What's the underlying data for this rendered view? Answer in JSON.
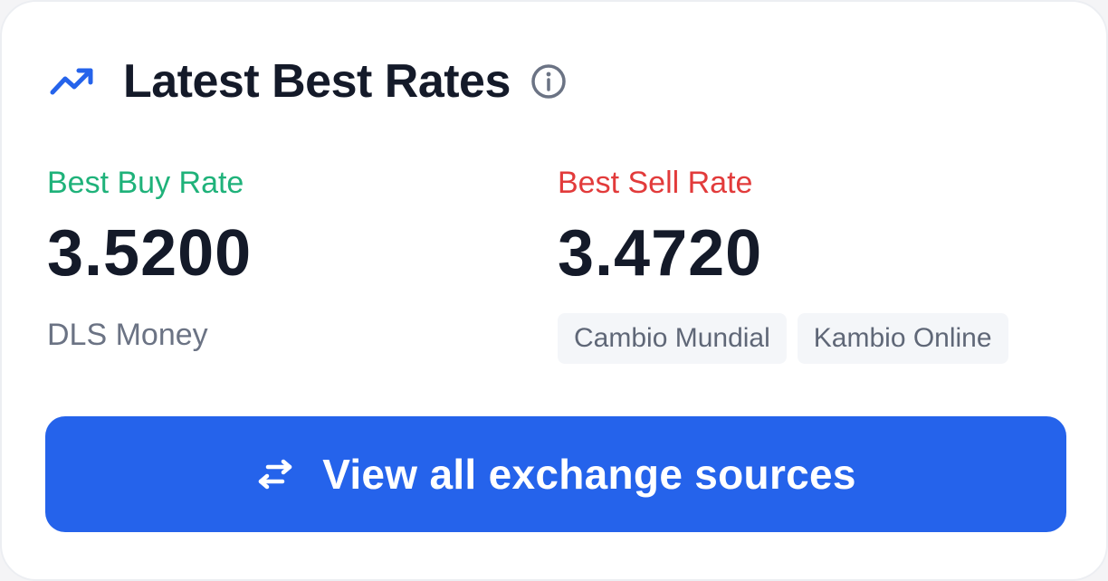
{
  "header": {
    "title": "Latest Best Rates",
    "icon": "trending-up-icon",
    "info_icon": "info-icon"
  },
  "buy": {
    "label": "Best Buy Rate",
    "value": "3.5200",
    "source": "DLS Money",
    "color": "#1fb27a"
  },
  "sell": {
    "label": "Best Sell Rate",
    "value": "3.4720",
    "sources": [
      "Cambio Mundial",
      "Kambio Online"
    ],
    "color": "#e23b3b"
  },
  "action": {
    "label": "View all exchange sources",
    "icon": "swap-arrows-icon",
    "color": "#2563eb"
  },
  "colors": {
    "title": "#141a29",
    "muted": "#6b7384",
    "chip_bg": "#f4f6f9"
  }
}
